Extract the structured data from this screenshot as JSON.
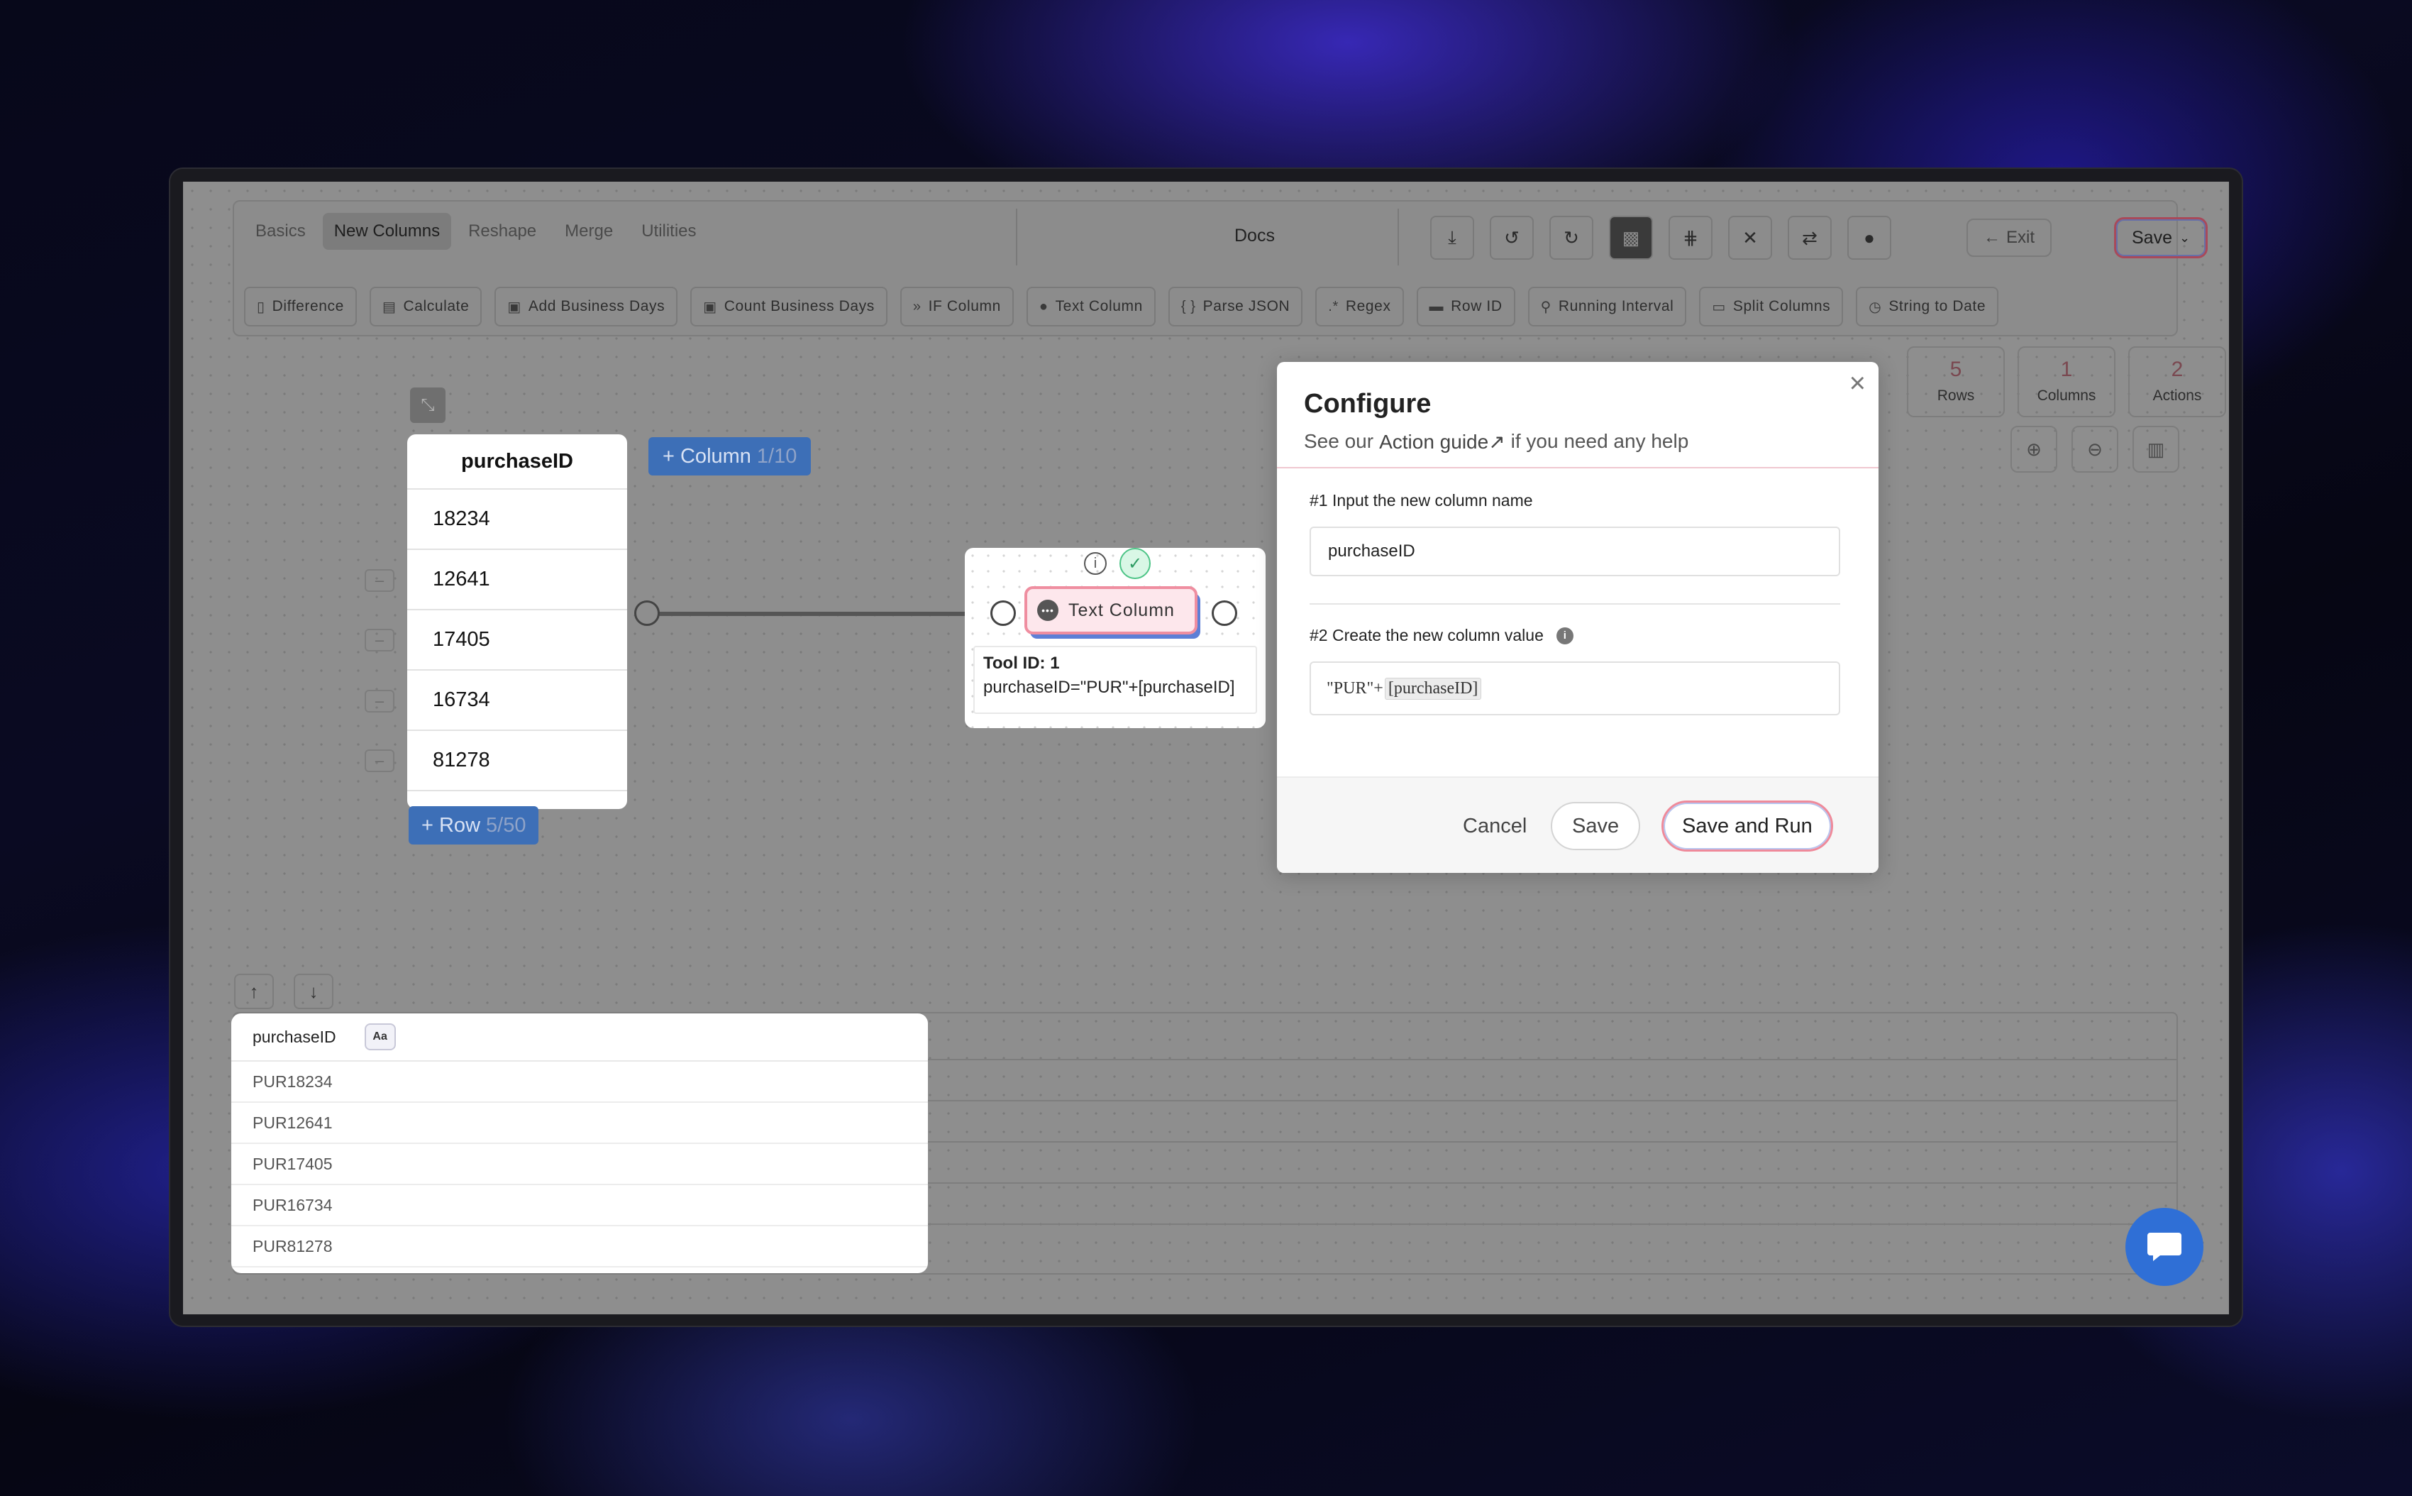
{
  "toolbar": {
    "tabs": [
      "Basics",
      "New Columns",
      "Reshape",
      "Merge",
      "Utilities"
    ],
    "docs_label": "Docs",
    "exit_label": "Exit",
    "save_label": "Save",
    "tools": [
      "Difference",
      "Calculate",
      "Add Business Days",
      "Count Business Days",
      "IF Column",
      "Text Column",
      "Parse JSON",
      "Regex",
      "Row ID",
      "Running Interval",
      "Split Columns",
      "String to Date"
    ]
  },
  "stats": {
    "rows": {
      "value": "5",
      "label": "Rows"
    },
    "columns": {
      "value": "1",
      "label": "Columns"
    },
    "actions": {
      "value": "2",
      "label": "Actions"
    }
  },
  "source_table": {
    "header": "purchaseID",
    "rows": [
      "18234",
      "12641",
      "17405",
      "16734",
      "81278"
    ],
    "add_column_label": "+ Column",
    "add_column_count": "1/10",
    "add_row_label": "+ Row",
    "add_row_count": "5/50"
  },
  "node": {
    "label": "Text Column",
    "tool_id": "Tool ID: 1",
    "formula": "purchaseID=\"PUR\"+[purchaseID]"
  },
  "result_table": {
    "header": "purchaseID",
    "type_badge": "Aa",
    "rows": [
      "PUR18234",
      "PUR12641",
      "PUR17405",
      "PUR16734",
      "PUR81278"
    ]
  },
  "modal": {
    "title": "Configure",
    "subtitle_prefix": "See our",
    "subtitle_link": "Action guide",
    "subtitle_suffix": "if you need any help",
    "step1_label": "#1 Input the new column name",
    "step1_value": "purchaseID",
    "step2_label": "#2 Create the new column value",
    "step2_value_literal": "\"PUR\"+",
    "step2_value_token": "[purchaseID]",
    "cancel_label": "Cancel",
    "save_label": "Save",
    "save_run_label": "Save and Run"
  },
  "colors": {
    "accent_blue": "#3d6fb7",
    "chip_pink": "#ef8ea0",
    "success_green": "#4cc486",
    "chat_blue": "#2f6fd6"
  },
  "icons": {
    "toolbar": [
      "download-icon",
      "undo-icon",
      "redo-icon",
      "layout-icon",
      "grid-icon",
      "close-icon",
      "swap-icon",
      "play-icon"
    ],
    "zoom": [
      "zoom-in-icon",
      "zoom-out-icon",
      "map-icon"
    ]
  }
}
